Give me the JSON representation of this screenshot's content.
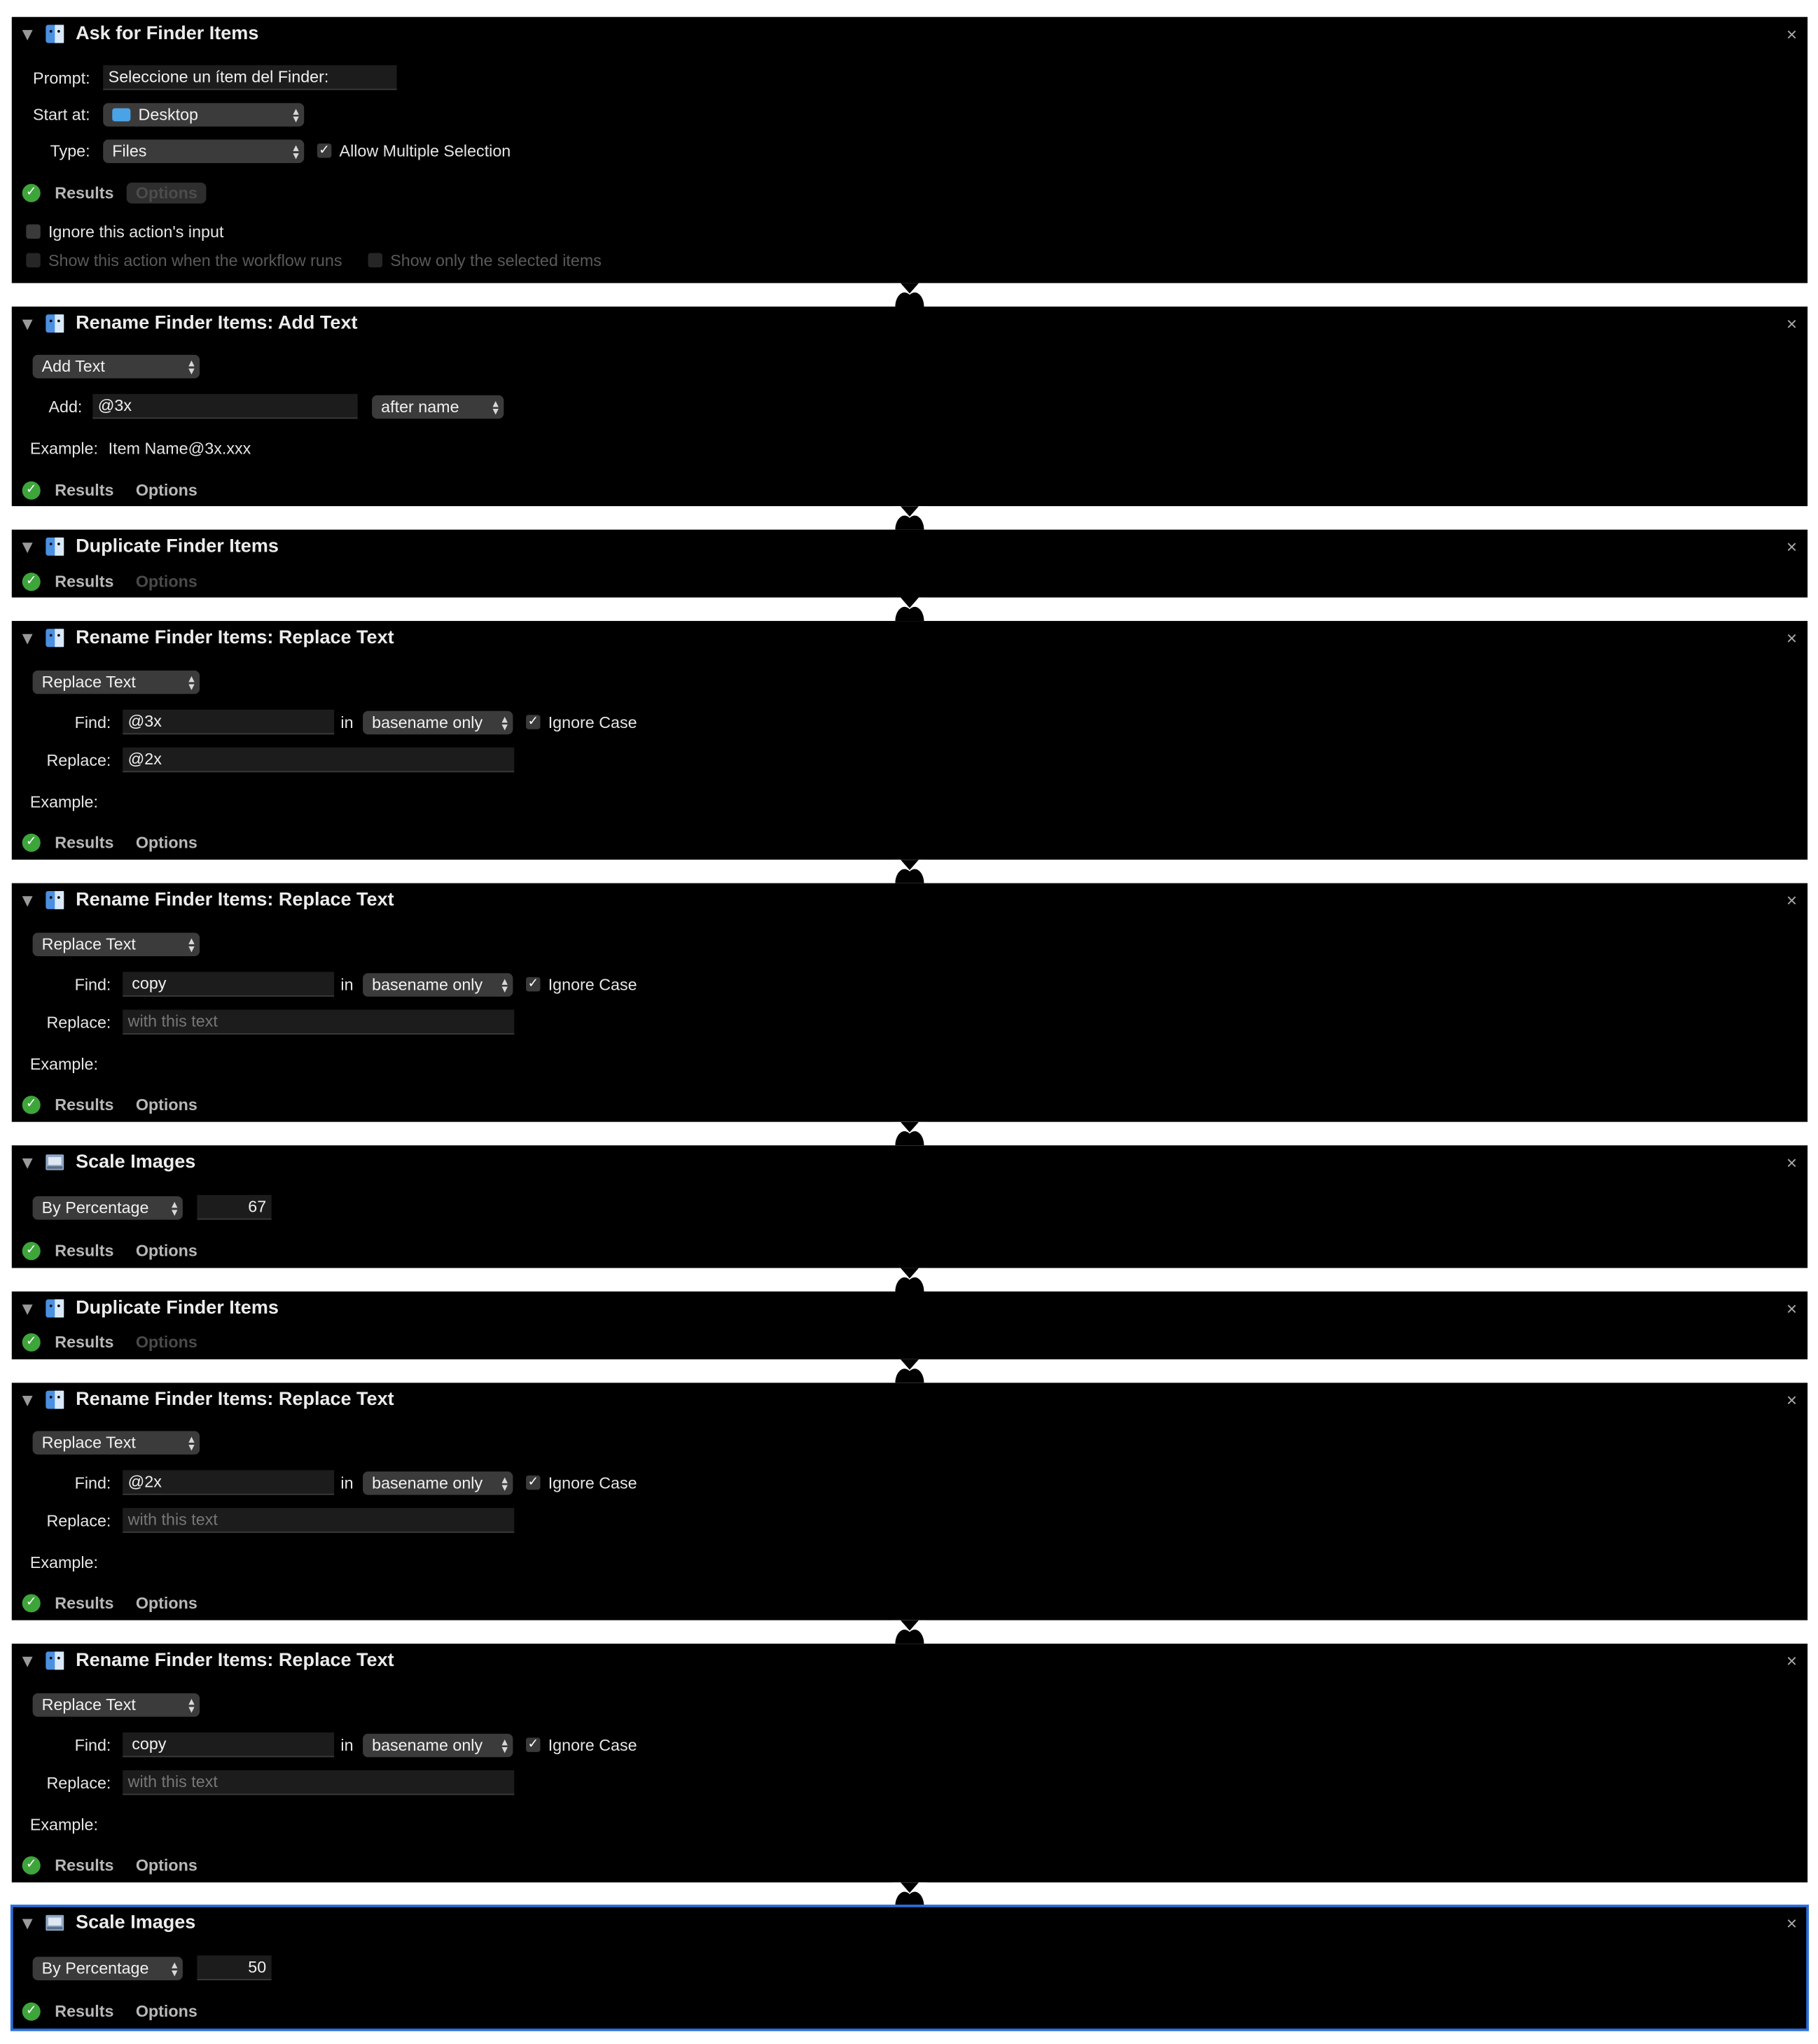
{
  "common": {
    "results_label": "Results",
    "options_label": "Options",
    "close_symbol": "×",
    "check_symbol": "✓",
    "example_label": "Example:",
    "find_label": "Find:",
    "in_label": "in",
    "replace_label": "Replace:",
    "ignore_case_label": "Ignore Case"
  },
  "ask": {
    "title": "Ask for Finder Items",
    "prompt_label": "Prompt:",
    "prompt_value": "Seleccione un ítem del Finder:",
    "start_label": "Start at:",
    "start_value": "Desktop",
    "type_label": "Type:",
    "type_value": "Files",
    "allow_multiple_label": "Allow Multiple Selection",
    "ignore_input_label": "Ignore this action's input",
    "show_action_label": "Show this action when the workflow runs",
    "show_selected_label": "Show only the selected items"
  },
  "add_text": {
    "title": "Rename Finder Items: Add Text",
    "mode": "Add Text",
    "add_label": "Add:",
    "add_value": "@3x",
    "position": "after name",
    "example_value": "Item Name@3x.xxx"
  },
  "dup1": {
    "title": "Duplicate Finder Items"
  },
  "rep1": {
    "title": "Rename Finder Items: Replace Text",
    "mode": "Replace Text",
    "find_value": "@3x",
    "scope": "basename only",
    "replace_value": "@2x"
  },
  "rep2": {
    "title": "Rename Finder Items: Replace Text",
    "mode": "Replace Text",
    "find_value": "copy",
    "scope": "basename only",
    "replace_placeholder": "with this text"
  },
  "scale1": {
    "title": "Scale Images",
    "mode": "By Percentage",
    "value": "67"
  },
  "dup2": {
    "title": "Duplicate Finder Items"
  },
  "rep3": {
    "title": "Rename Finder Items: Replace Text",
    "mode": "Replace Text",
    "find_value": "@2x",
    "scope": "basename only",
    "replace_placeholder": "with this text"
  },
  "rep4": {
    "title": "Rename Finder Items: Replace Text",
    "mode": "Replace Text",
    "find_value": "copy",
    "scope": "basename only",
    "replace_placeholder": "with this text"
  },
  "scale2": {
    "title": "Scale Images",
    "mode": "By Percentage",
    "value": "50"
  }
}
